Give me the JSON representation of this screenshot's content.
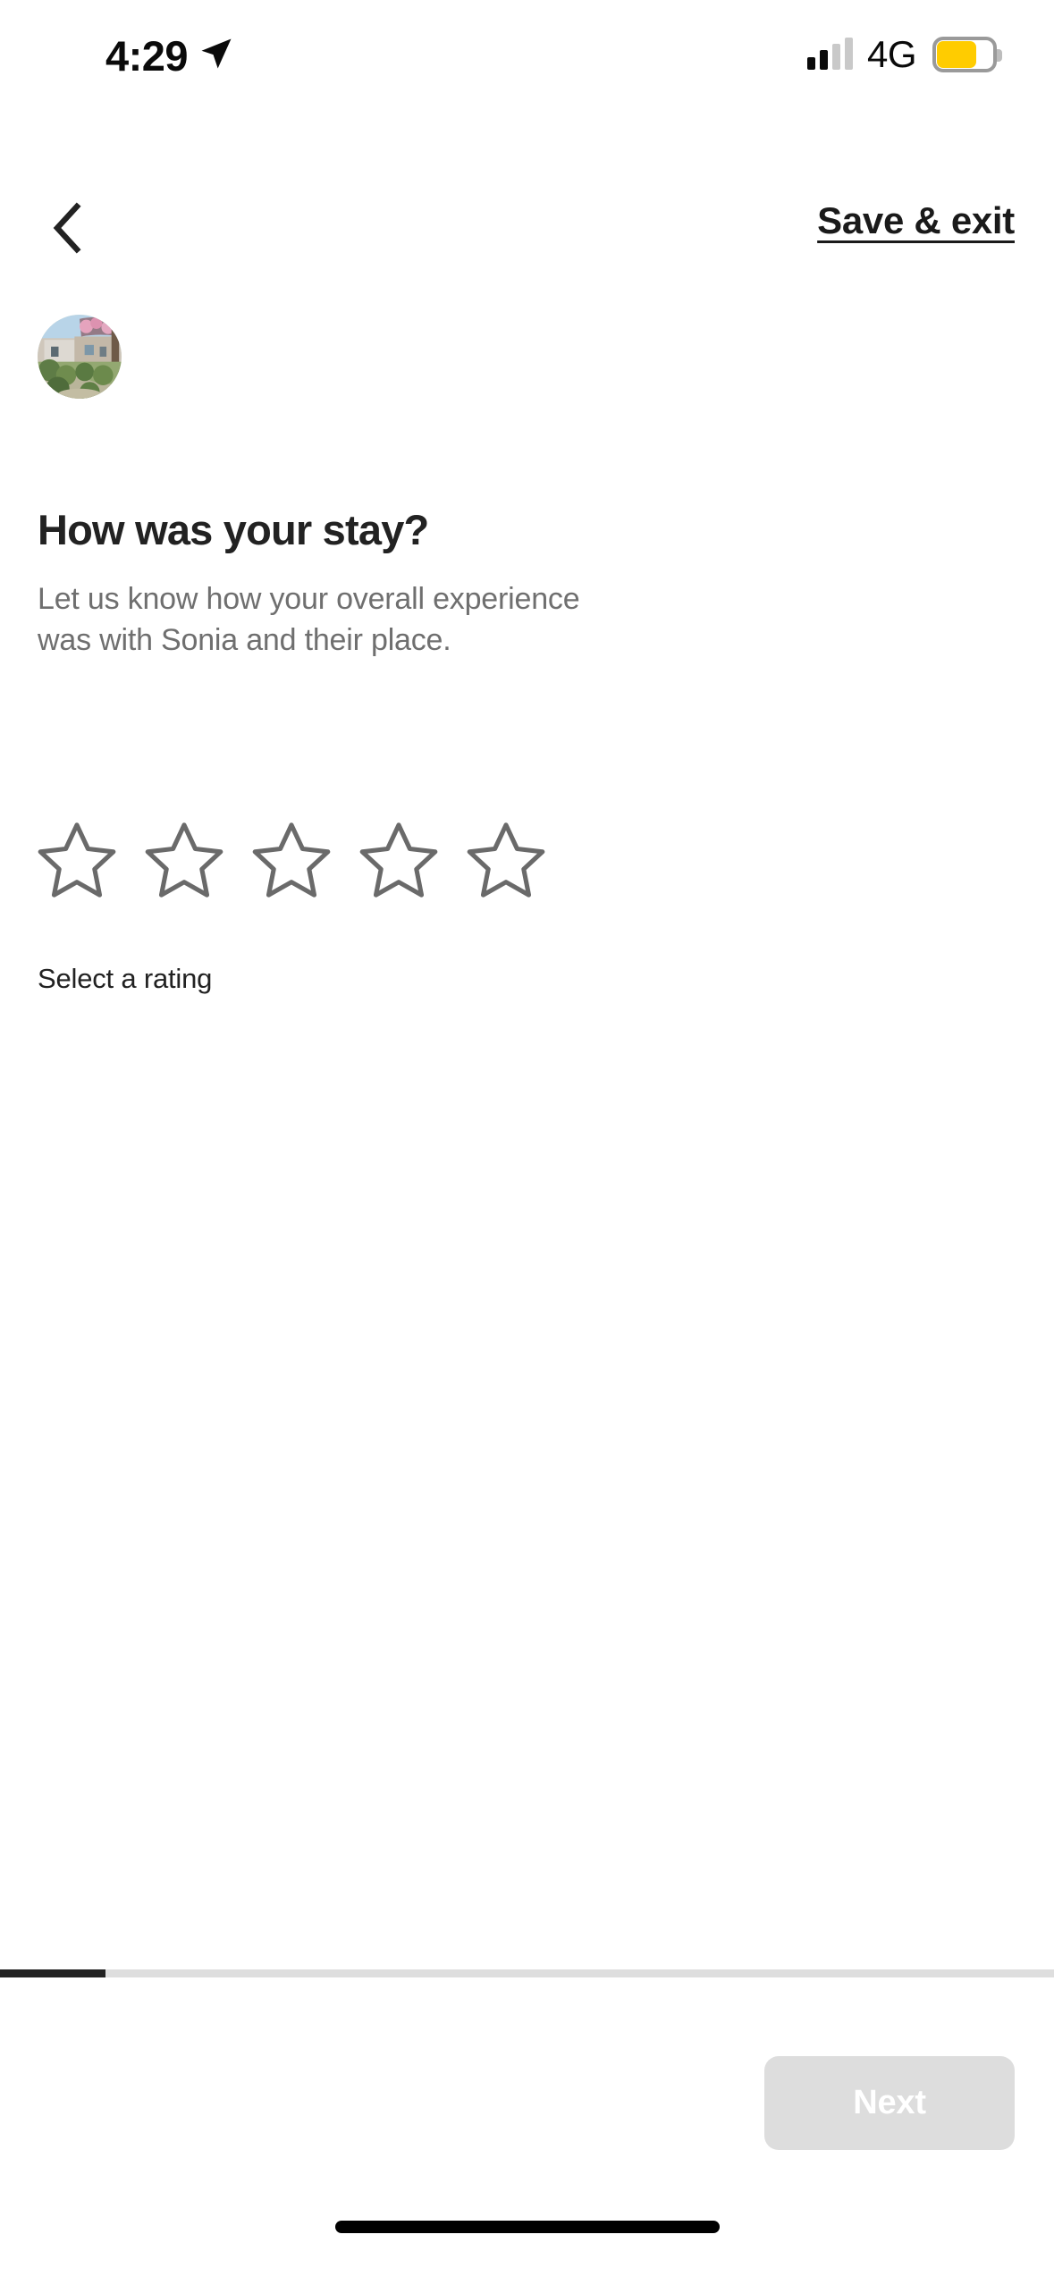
{
  "status_bar": {
    "time": "4:29",
    "location_icon": "location-arrow-icon",
    "signal_icon": "cellular-signal-icon",
    "network": "4G",
    "battery_icon": "battery-low-power-icon",
    "battery_color": "#ffcc00"
  },
  "nav": {
    "back_icon": "chevron-left-icon",
    "save_exit_label": "Save & exit"
  },
  "main": {
    "avatar_alt": "listing-photo",
    "headline": "How was your stay?",
    "subhead": "Let us know how your overall experience was with Sonia and their place.",
    "host_name": "Sonia",
    "rating_hint": "Select a rating",
    "stars": [
      {
        "index": 1,
        "state": "empty"
      },
      {
        "index": 2,
        "state": "empty"
      },
      {
        "index": 3,
        "state": "empty"
      },
      {
        "index": 4,
        "state": "empty"
      },
      {
        "index": 5,
        "state": "empty"
      }
    ],
    "selected_rating": 0
  },
  "footer": {
    "progress_percent": 10,
    "next_label": "Next",
    "next_enabled": false
  },
  "colors": {
    "text_primary": "#222222",
    "text_secondary": "#6f6f6f",
    "star_outline": "#6a6a6a",
    "progress_fill": "#222222",
    "progress_track": "#dedede",
    "button_disabled": "#dddddd"
  }
}
